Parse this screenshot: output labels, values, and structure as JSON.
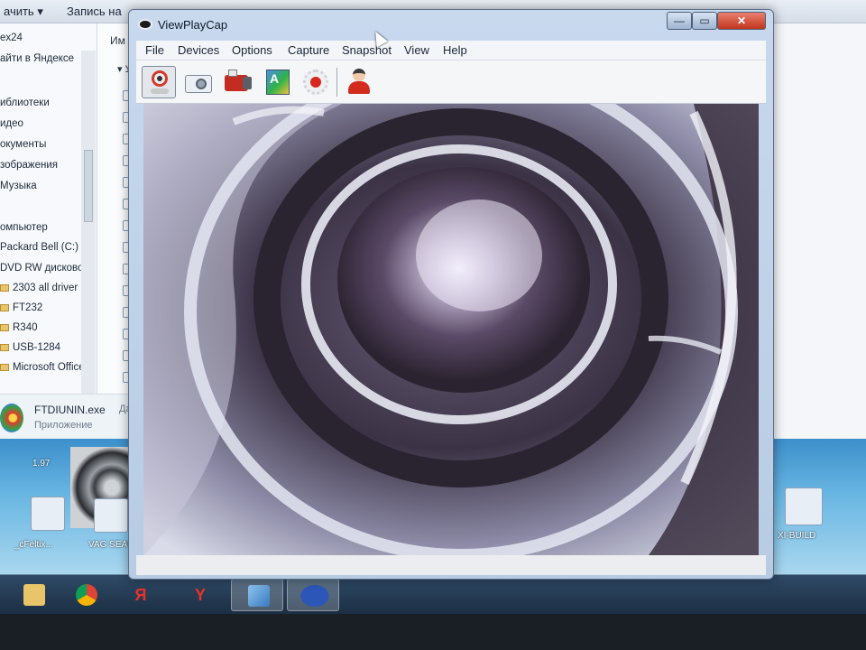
{
  "explorer": {
    "toolbar_left": "ачить ▾",
    "toolbar_right": "Запись на",
    "column_header": "Им",
    "nav_items": [
      {
        "label": "ex24"
      },
      {
        "label": "айти в Яндексе"
      },
      {
        "label": "иблиотеки"
      },
      {
        "label": "идео"
      },
      {
        "label": "окументы"
      },
      {
        "label": "зображения"
      },
      {
        "label": "Музыка"
      },
      {
        "label": "омпьютер"
      },
      {
        "label": "Packard Bell (C:)"
      },
      {
        "label": "DVD RW дисково"
      },
      {
        "label": "2303 all driver"
      },
      {
        "label": "FT232"
      },
      {
        "label": "R340"
      },
      {
        "label": "USB-1284"
      },
      {
        "label": "Microsoft Office"
      }
    ],
    "column_row_prefix": "У",
    "details": {
      "file_name": "FTDIUNIN.exe",
      "file_type": "Приложение",
      "date_label": "Дата с"
    }
  },
  "desktop": {
    "labels": [
      "1.97",
      "_cFeltix...",
      "VAG SEAR",
      "XI-BUILD"
    ]
  },
  "viewplaycap": {
    "title": "ViewPlayCap",
    "window_buttons": {
      "minimize": "—",
      "maximize": "▭",
      "close": "✕"
    },
    "menu": [
      "File",
      "Devices",
      "Options",
      "Capture",
      "Snapshot",
      "View",
      "Help"
    ],
    "toolbar_tools": [
      "webcam",
      "camera",
      "camcorder",
      "palette",
      "record",
      "user"
    ],
    "palette_glyph": "A"
  },
  "taskbar": {
    "yandex1": "Я",
    "yandex2": "Y"
  },
  "colors": {
    "accent_red": "#d42b1f",
    "titlebar": "#c8d9ee",
    "taskbar": "#1c2f44"
  }
}
